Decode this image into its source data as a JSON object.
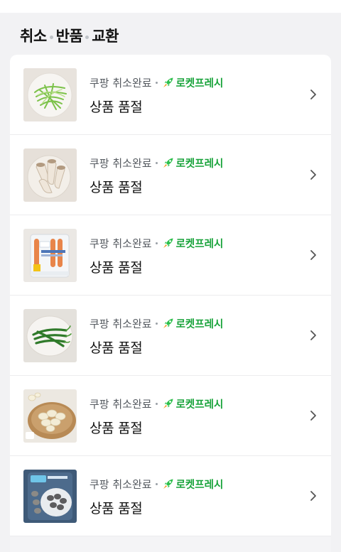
{
  "section": {
    "title_parts": [
      "취소",
      "반품",
      "교환"
    ]
  },
  "orders": [
    {
      "seller": "쿠팡 취소완료",
      "badge": "로켓프레시",
      "status": "상품 품절",
      "image": "bean-sprouts"
    },
    {
      "seller": "쿠팡 취소완료",
      "badge": "로켓프레시",
      "status": "상품 품절",
      "image": "king-oyster-mushrooms"
    },
    {
      "seller": "쿠팡 취소완료",
      "badge": "로켓프레시",
      "status": "상품 품절",
      "image": "sausage-pack"
    },
    {
      "seller": "쿠팡 취소완료",
      "badge": "로켓프레시",
      "status": "상품 품절",
      "image": "green-chili-peppers"
    },
    {
      "seller": "쿠팡 취소완료",
      "badge": "로켓프레시",
      "status": "상품 품절",
      "image": "peeled-garlic"
    },
    {
      "seller": "쿠팡 취소완료",
      "badge": "로켓프레시",
      "status": "상품 품절",
      "image": "clams-pack"
    }
  ],
  "icons": {
    "rocket": "rocket-icon",
    "chevron": "chevron-right-icon"
  },
  "colors": {
    "badge_green": "#18a33a",
    "rocket_green": "#2bbf4a"
  }
}
